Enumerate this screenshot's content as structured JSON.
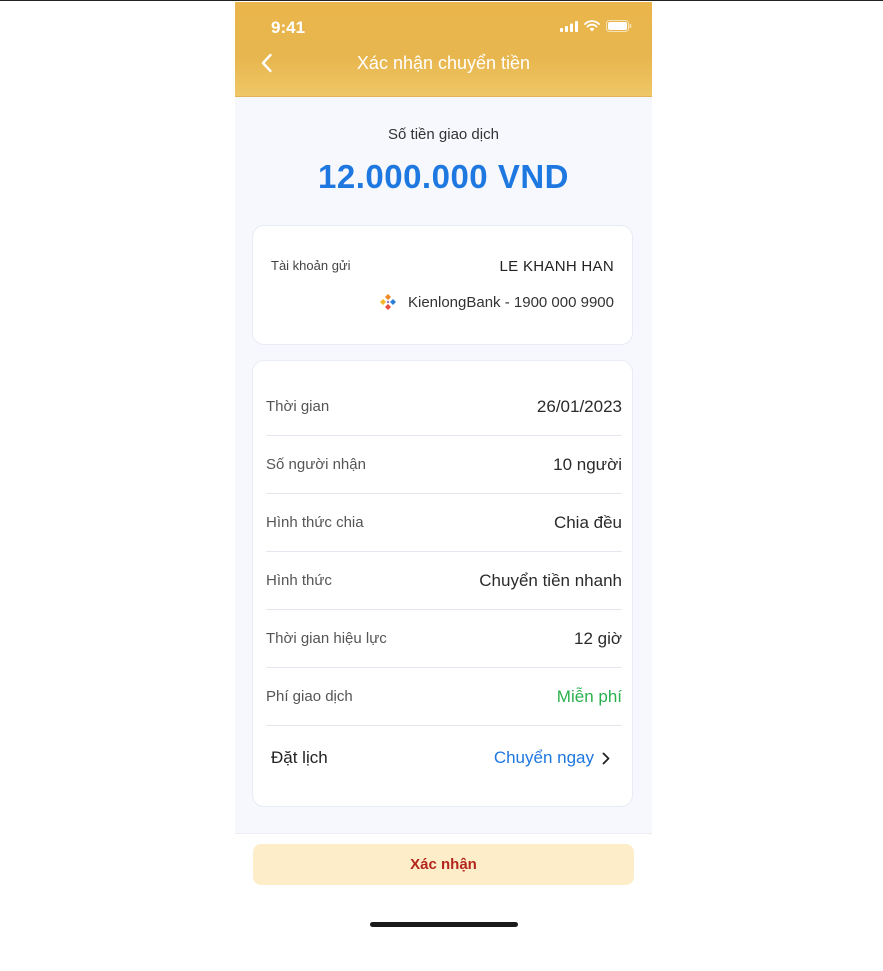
{
  "status_bar": {
    "time": "9:41",
    "icons": [
      "signal-icon",
      "wifi-icon",
      "battery-icon"
    ]
  },
  "header": {
    "title": "Xác nhận chuyển tiền",
    "back_icon": "chevron-left-icon"
  },
  "amount": {
    "label": "Số tiền giao dịch",
    "value": "12.000.000 VND"
  },
  "sender": {
    "label": "Tài khoản gửi",
    "name": "LE KHANH HAN",
    "bank": "KienlongBank - 1900 000 9900",
    "bank_logo_icon": "kienlongbank-logo-icon"
  },
  "details": [
    {
      "label": "Thời gian",
      "value": "26/01/2023"
    },
    {
      "label": "Số người nhận",
      "value": "10 người"
    },
    {
      "label": "Hình thức chia",
      "value": "Chia đều"
    },
    {
      "label": "Hình thức",
      "value": "Chuyển tiền nhanh"
    },
    {
      "label": "Thời gian hiệu lực",
      "value": "12 giờ"
    },
    {
      "label": "Phí giao dịch",
      "value": "Miễn phí"
    }
  ],
  "schedule": {
    "label": "Đặt lịch",
    "value": "Chuyển ngay",
    "icon": "chevron-right-icon"
  },
  "confirm_button": "Xác nhận",
  "colors": {
    "header": "#E8B64E",
    "accent_blue": "#1E78E0",
    "free_green": "#2AB14D",
    "button_bg": "#FDEEC9",
    "button_text": "#B3261E"
  }
}
